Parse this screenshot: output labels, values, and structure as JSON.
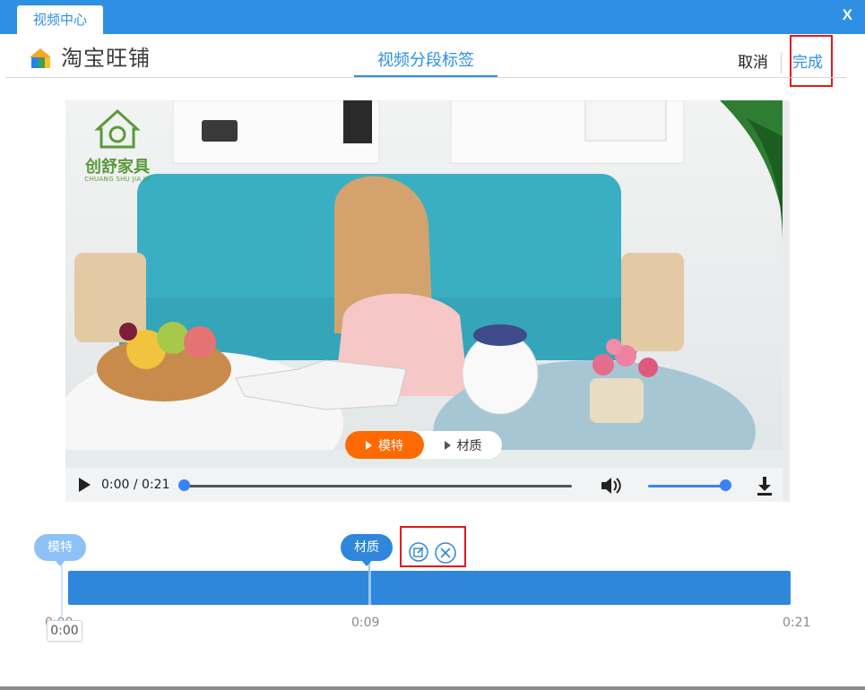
{
  "window": {
    "tab_title": "视频中心",
    "close_label": "X"
  },
  "header": {
    "logo_text": "淘宝旺铺",
    "center_tab": "视频分段标签",
    "cancel_label": "取消",
    "done_label": "完成"
  },
  "video": {
    "brand_name": "创舒家具",
    "brand_sub": "CHUANG SHU JIA JU",
    "segments": [
      {
        "label": "模特",
        "active": true
      },
      {
        "label": "材质",
        "active": false
      }
    ]
  },
  "player": {
    "time_text": "0:00 / 0:21",
    "progress_fraction": 0.0,
    "volume_fraction": 1.0
  },
  "timeline": {
    "tags": [
      {
        "label": "模特",
        "time_seconds": 0
      },
      {
        "label": "材质",
        "time_seconds": 9
      }
    ],
    "duration_seconds": 21,
    "ticks": [
      "0:00",
      "0:09",
      "0:21"
    ],
    "cursor_label": "0:00"
  },
  "colors": {
    "accent": "#2f8fe3",
    "active_segment": "#ff6a00",
    "highlight": "#e0191e"
  },
  "icons": [
    "play-icon",
    "volume-icon",
    "download-icon",
    "edit-icon",
    "delete-icon",
    "close-icon"
  ]
}
